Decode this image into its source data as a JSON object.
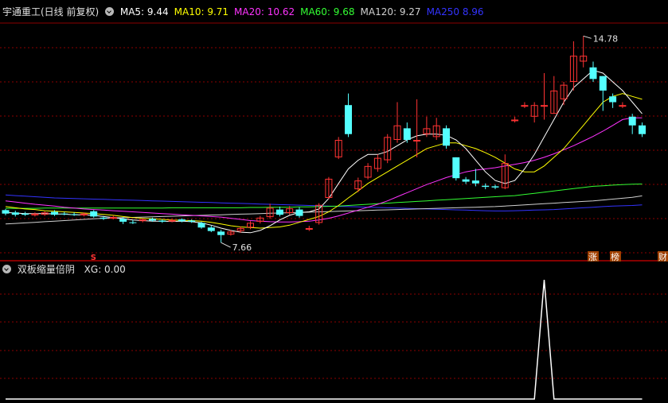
{
  "main_header": {
    "title": "宇通重工(日线 前复权)",
    "indicators": [
      {
        "label": "MA5: 9.44",
        "color": "#ffffff"
      },
      {
        "label": "MA10: 9.71",
        "color": "#ffff00"
      },
      {
        "label": "MA20: 10.62",
        "color": "#ff33ff"
      },
      {
        "label": "MA60: 9.68",
        "color": "#33ff33"
      },
      {
        "label": "MA120: 9.27",
        "color": "#d0d0d0"
      },
      {
        "label": "MA250  8.96",
        "color": "#3333ff"
      }
    ]
  },
  "annotations": {
    "high_label": "14.78",
    "low_label": "7.66",
    "marker_s": "S",
    "badges": [
      "涨",
      "榜",
      "财"
    ]
  },
  "sub_header": {
    "title": "双板缩量倍阴",
    "indicator": "XG: 0.00"
  },
  "colors": {
    "background": "#000000",
    "up": "#ff3333",
    "down": "#54ffff",
    "grid": "#8b0000",
    "divider": "#b00000",
    "ma5": "#ffffff",
    "ma10": "#ffff00",
    "ma20": "#ff33ff",
    "ma60": "#33ff33",
    "ma120": "#d0d0d0",
    "ma250": "#3333ff",
    "signal": "#ffffff",
    "badge_bg": "#a04000"
  },
  "chart_data": [
    {
      "type": "candlestick",
      "title": "宇通重工(日线 前复权)",
      "ylim": [
        7.2,
        15.2
      ],
      "candles": [
        [
          8.78,
          8.66,
          8.82,
          8.6
        ],
        [
          8.7,
          8.62,
          8.76,
          8.56
        ],
        [
          8.66,
          8.62,
          8.72,
          8.58
        ],
        [
          8.6,
          8.66,
          8.7,
          8.56
        ],
        [
          8.62,
          8.7,
          8.74,
          8.58
        ],
        [
          8.72,
          8.62,
          8.78,
          8.58
        ],
        [
          8.66,
          8.64,
          8.72,
          8.6
        ],
        [
          8.64,
          8.62,
          8.7,
          8.58
        ],
        [
          8.6,
          8.66,
          8.7,
          8.56
        ],
        [
          8.74,
          8.56,
          8.78,
          8.52
        ],
        [
          8.52,
          8.48,
          8.58,
          8.44
        ],
        [
          8.5,
          8.54,
          8.6,
          8.46
        ],
        [
          8.48,
          8.38,
          8.54,
          8.3
        ],
        [
          8.36,
          8.34,
          8.44,
          8.3
        ],
        [
          8.4,
          8.46,
          8.5,
          8.36
        ],
        [
          8.48,
          8.42,
          8.52,
          8.38
        ],
        [
          8.42,
          8.38,
          8.46,
          8.34
        ],
        [
          8.4,
          8.44,
          8.48,
          8.36
        ],
        [
          8.46,
          8.4,
          8.5,
          8.36
        ],
        [
          8.42,
          8.38,
          8.46,
          8.34
        ],
        [
          8.34,
          8.18,
          8.38,
          8.14
        ],
        [
          8.18,
          8.06,
          8.24,
          8.02
        ],
        [
          8.04,
          7.92,
          8.1,
          7.66
        ],
        [
          7.94,
          8.04,
          8.1,
          7.9
        ],
        [
          8.06,
          8.16,
          8.22,
          8.0
        ],
        [
          8.18,
          8.34,
          8.4,
          8.12
        ],
        [
          8.38,
          8.52,
          8.58,
          8.32
        ],
        [
          8.54,
          8.86,
          9.0,
          8.48
        ],
        [
          8.8,
          8.62,
          8.9,
          8.56
        ],
        [
          8.68,
          8.84,
          8.92,
          8.62
        ],
        [
          8.8,
          8.58,
          8.88,
          8.52
        ],
        [
          8.14,
          8.16,
          8.24,
          8.06
        ],
        [
          8.34,
          8.96,
          9.02,
          8.28
        ],
        [
          9.2,
          9.86,
          9.92,
          9.16
        ],
        [
          10.6,
          11.2,
          11.3,
          10.54
        ],
        [
          12.4,
          11.4,
          12.8,
          11.3
        ],
        [
          9.5,
          9.8,
          9.9,
          9.4
        ],
        [
          9.9,
          10.3,
          10.4,
          9.84
        ],
        [
          10.2,
          10.58,
          10.7,
          10.1
        ],
        [
          10.5,
          11.3,
          11.4,
          10.4
        ],
        [
          11.2,
          11.7,
          12.5,
          11.1
        ],
        [
          11.6,
          11.2,
          11.8,
          11.1
        ],
        [
          11.2,
          11.2,
          12.6,
          10.6
        ],
        [
          11.4,
          11.6,
          12.0,
          11.3
        ],
        [
          11.3,
          11.7,
          11.96,
          11.2
        ],
        [
          11.6,
          11.0,
          11.7,
          10.9
        ],
        [
          10.6,
          9.88,
          10.6,
          9.8
        ],
        [
          9.84,
          9.76,
          9.92,
          9.68
        ],
        [
          9.8,
          9.7,
          10.2,
          9.6
        ],
        [
          9.62,
          9.58,
          9.7,
          9.5
        ],
        [
          9.6,
          9.56,
          9.66,
          9.5
        ],
        [
          9.54,
          10.4,
          10.7,
          9.5
        ],
        [
          11.9,
          11.9,
          12.0,
          11.8
        ],
        [
          12.4,
          12.4,
          12.5,
          12.3
        ],
        [
          12.0,
          12.4,
          12.5,
          11.8
        ],
        [
          12.4,
          12.4,
          13.5,
          11.9
        ],
        [
          12.1,
          12.9,
          13.4,
          12.1
        ],
        [
          12.6,
          13.1,
          13.2,
          12.4
        ],
        [
          13.2,
          14.1,
          14.6,
          12.9
        ],
        [
          13.9,
          14.1,
          14.78,
          13.7
        ],
        [
          13.7,
          13.3,
          13.9,
          13.2
        ],
        [
          13.4,
          12.9,
          13.4,
          12.2
        ],
        [
          12.7,
          12.5,
          12.8,
          12.3
        ],
        [
          12.4,
          12.4,
          12.5,
          12.3
        ],
        [
          12.0,
          11.7,
          12.1,
          11.4
        ],
        [
          11.7,
          11.4,
          11.8,
          11.3
        ]
      ],
      "ma5": [
        8.7,
        8.68,
        8.66,
        8.66,
        8.66,
        8.65,
        8.64,
        8.62,
        8.62,
        8.6,
        8.56,
        8.52,
        8.48,
        8.44,
        8.42,
        8.4,
        8.4,
        8.39,
        8.4,
        8.38,
        8.34,
        8.26,
        8.16,
        8.08,
        8.02,
        8.0,
        8.08,
        8.24,
        8.44,
        8.6,
        8.7,
        8.72,
        8.82,
        9.18,
        9.7,
        10.2,
        10.5,
        10.7,
        10.7,
        10.8,
        11.0,
        11.2,
        11.34,
        11.4,
        11.4,
        11.36,
        11.2,
        10.9,
        10.5,
        10.1,
        9.8,
        9.7,
        9.8,
        10.2,
        10.7,
        11.3,
        11.9,
        12.5,
        13.0,
        13.3,
        13.6,
        13.5,
        13.2,
        12.9,
        12.5,
        12.1
      ],
      "ma10": [
        8.9,
        8.86,
        8.82,
        8.8,
        8.76,
        8.74,
        8.72,
        8.7,
        8.68,
        8.66,
        8.63,
        8.6,
        8.56,
        8.52,
        8.5,
        8.48,
        8.46,
        8.44,
        8.43,
        8.42,
        8.4,
        8.36,
        8.3,
        8.24,
        8.2,
        8.18,
        8.16,
        8.18,
        8.2,
        8.26,
        8.36,
        8.46,
        8.56,
        8.72,
        8.94,
        9.2,
        9.44,
        9.7,
        9.9,
        10.1,
        10.3,
        10.5,
        10.7,
        10.9,
        11.0,
        11.1,
        11.1,
        11.0,
        10.9,
        10.76,
        10.6,
        10.4,
        10.2,
        10.1,
        10.1,
        10.3,
        10.6,
        10.9,
        11.3,
        11.7,
        12.1,
        12.5,
        12.7,
        12.8,
        12.7,
        12.6
      ],
      "ma20": [
        9.1,
        9.06,
        9.02,
        8.98,
        8.95,
        8.92,
        8.88,
        8.85,
        8.82,
        8.8,
        8.78,
        8.76,
        8.74,
        8.72,
        8.7,
        8.68,
        8.66,
        8.64,
        8.62,
        8.6,
        8.58,
        8.56,
        8.54,
        8.5,
        8.46,
        8.42,
        8.4,
        8.38,
        8.37,
        8.37,
        8.38,
        8.4,
        8.44,
        8.5,
        8.58,
        8.68,
        8.78,
        8.88,
        8.98,
        9.1,
        9.24,
        9.38,
        9.52,
        9.66,
        9.78,
        9.9,
        10.0,
        10.1,
        10.16,
        10.2,
        10.24,
        10.3,
        10.36,
        10.42,
        10.5,
        10.6,
        10.72,
        10.86,
        11.0,
        11.16,
        11.32,
        11.5,
        11.7,
        11.9,
        11.96,
        11.96
      ],
      "ma60": [
        8.84,
        8.84,
        8.84,
        8.84,
        8.85,
        8.85,
        8.85,
        8.85,
        8.85,
        8.85,
        8.85,
        8.85,
        8.85,
        8.85,
        8.85,
        8.85,
        8.85,
        8.86,
        8.86,
        8.86,
        8.86,
        8.86,
        8.86,
        8.86,
        8.86,
        8.87,
        8.87,
        8.88,
        8.88,
        8.88,
        8.89,
        8.89,
        8.9,
        8.91,
        8.92,
        8.94,
        8.96,
        8.98,
        9.0,
        9.02,
        9.04,
        9.06,
        9.08,
        9.1,
        9.12,
        9.14,
        9.16,
        9.18,
        9.2,
        9.22,
        9.24,
        9.26,
        9.28,
        9.32,
        9.36,
        9.4,
        9.44,
        9.48,
        9.52,
        9.56,
        9.6,
        9.62,
        9.64,
        9.66,
        9.67,
        9.68
      ],
      "ma120": [
        8.3,
        8.32,
        8.34,
        8.36,
        8.38,
        8.4,
        8.42,
        8.44,
        8.46,
        8.48,
        8.5,
        8.51,
        8.52,
        8.53,
        8.54,
        8.55,
        8.56,
        8.57,
        8.58,
        8.59,
        8.6,
        8.61,
        8.62,
        8.63,
        8.64,
        8.65,
        8.66,
        8.67,
        8.68,
        8.69,
        8.7,
        8.71,
        8.72,
        8.73,
        8.74,
        8.75,
        8.76,
        8.77,
        8.78,
        8.79,
        8.8,
        8.81,
        8.82,
        8.83,
        8.84,
        8.85,
        8.86,
        8.87,
        8.88,
        8.89,
        8.9,
        8.92,
        8.94,
        8.96,
        8.98,
        9.0,
        9.02,
        9.04,
        9.06,
        9.08,
        9.1,
        9.13,
        9.16,
        9.19,
        9.22,
        9.27
      ],
      "ma250": [
        9.3,
        9.28,
        9.26,
        9.24,
        9.22,
        9.2,
        9.19,
        9.18,
        9.17,
        9.16,
        9.15,
        9.14,
        9.13,
        9.12,
        9.11,
        9.1,
        9.09,
        9.08,
        9.07,
        9.06,
        9.05,
        9.04,
        9.03,
        9.02,
        9.01,
        9.0,
        8.99,
        8.98,
        8.97,
        8.96,
        8.95,
        8.94,
        8.93,
        8.92,
        8.91,
        8.9,
        8.89,
        8.88,
        8.87,
        8.86,
        8.85,
        8.84,
        8.83,
        8.82,
        8.81,
        8.8,
        8.79,
        8.78,
        8.77,
        8.76,
        8.75,
        8.75,
        8.76,
        8.77,
        8.78,
        8.79,
        8.8,
        8.82,
        8.84,
        8.86,
        8.88,
        8.9,
        8.92,
        8.93,
        8.94,
        8.96
      ],
      "annotations": [
        {
          "text": "14.78",
          "x": 59,
          "y": 14.78
        },
        {
          "text": "7.66",
          "x": 22,
          "y": 7.66
        }
      ]
    },
    {
      "type": "line",
      "title": "双板缩量倍阴",
      "series": [
        {
          "name": "XG",
          "values": [
            0,
            0,
            0,
            0,
            0,
            0,
            0,
            0,
            0,
            0,
            0,
            0,
            0,
            0,
            0,
            0,
            0,
            0,
            0,
            0,
            0,
            0,
            0,
            0,
            0,
            0,
            0,
            0,
            0,
            0,
            0,
            0,
            0,
            0,
            0,
            0,
            0,
            0,
            0,
            0,
            0,
            0,
            0,
            0,
            0,
            0,
            0,
            0,
            0,
            0,
            0,
            0,
            0,
            0,
            0,
            1,
            0,
            0,
            0,
            0,
            0,
            0,
            0,
            0,
            0,
            0
          ]
        }
      ],
      "ylim": [
        0,
        1
      ]
    }
  ]
}
